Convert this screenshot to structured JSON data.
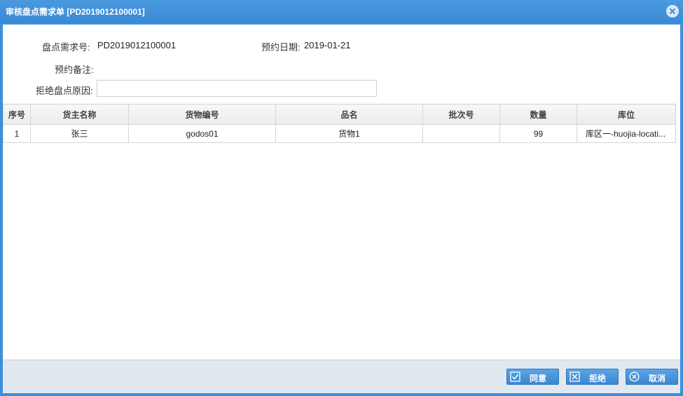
{
  "dialog": {
    "title": "审核盘点需求单 [PD2019012100001]"
  },
  "form": {
    "order_no_label": "盘点需求号:",
    "order_no_value": "PD2019012100001",
    "date_label": "预约日期:",
    "date_value": "2019-01-21",
    "remark_label": "预约备注:",
    "remark_value": "",
    "reject_label": "拒绝盘点原因:",
    "reject_value": ""
  },
  "table": {
    "columns": [
      "序号",
      "货主名称",
      "货物编号",
      "品名",
      "批次号",
      "数量",
      "库位"
    ],
    "rows": [
      [
        "1",
        "张三",
        "godos01",
        "货物1",
        "",
        "99",
        "库区一-huojia-locati..."
      ]
    ]
  },
  "footer": {
    "agree_label": "同意",
    "reject_label": "拒绝",
    "cancel_label": "取消"
  },
  "colors": {
    "titlebar": "#3c8fd8",
    "footer": "#e1e8f0",
    "button": "#3a87cf"
  }
}
